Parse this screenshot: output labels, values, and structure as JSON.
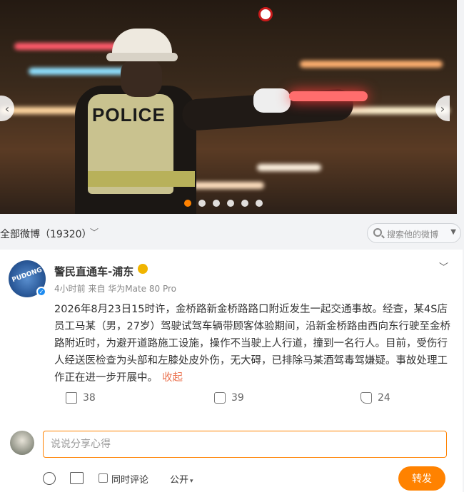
{
  "banner": {
    "vest_text": "POLICE",
    "dots_count": 6,
    "active_dot_index": 0
  },
  "feed_filter": {
    "label": "全部微博（19320）",
    "search_placeholder": "搜索他的微博"
  },
  "post": {
    "author": "警民直通车-浦东",
    "meta": "4小时前  来自 华为Mate 80 Pro",
    "content": "2026年8月23日15时许，金桥路新金桥路路口附近发生一起交通事故。经查，某4S店员工马某（男，27岁）驾驶试驾车辆带顾客体验期间，沿新金桥路由西向东行驶至金桥路附近时，为避开道路施工设施，操作不当驶上人行道，撞到一名行人。目前，受伤行人经送医检查为头部和左膝处皮外伤，无大碍，已排除马某酒驾毒驾嫌疑。事故处理工作正在进一步开展中。",
    "collapse_label": "收起",
    "stats": {
      "reposts": "38",
      "comments": "39",
      "likes": "24"
    }
  },
  "reply": {
    "placeholder": "说说分享心得",
    "also_comment_label": "同时评论",
    "visibility_label": "公开",
    "submit_label": "转发"
  },
  "colors": {
    "accent": "#ff8200",
    "link": "#eb7350",
    "verify": "#1d8bf0"
  }
}
